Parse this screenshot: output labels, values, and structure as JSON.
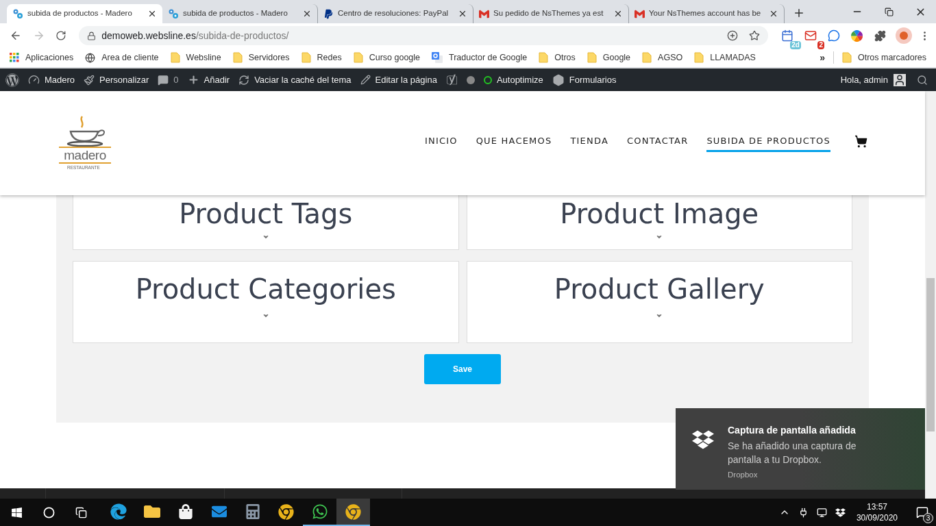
{
  "browser": {
    "tabs": [
      {
        "title": "subida de productos - Madero",
        "kind": "site",
        "selected": true
      },
      {
        "title": "subida de productos - Madero",
        "kind": "site",
        "selected": false
      },
      {
        "title": "Centro de resoluciones: PayPal",
        "kind": "paypal",
        "selected": false
      },
      {
        "title": "Su pedido de NsThemes ya est",
        "kind": "gmail",
        "selected": false
      },
      {
        "title": "Your NsThemes account has be",
        "kind": "gmail",
        "selected": false
      }
    ],
    "address": {
      "host": "demoweb.websline.es",
      "path": "/subida-de-productos/"
    },
    "extensions": [
      {
        "kind": "calendar",
        "badge": "2d"
      },
      {
        "kind": "mail",
        "badge": "2"
      },
      {
        "kind": "chat"
      },
      {
        "kind": "color"
      },
      {
        "kind": "puzzle"
      },
      {
        "kind": "avatar"
      }
    ],
    "bookmarks": [
      {
        "label": "Aplicaciones",
        "kind": "apps"
      },
      {
        "label": "Area de cliente",
        "kind": "globe"
      },
      {
        "label": "Websline",
        "kind": "folder"
      },
      {
        "label": "Servidores",
        "kind": "folder"
      },
      {
        "label": "Redes",
        "kind": "folder"
      },
      {
        "label": "Curso google",
        "kind": "folder"
      },
      {
        "label": "Traductor de Google",
        "kind": "translate"
      },
      {
        "label": "Otros",
        "kind": "folder"
      },
      {
        "label": "Google",
        "kind": "folder"
      },
      {
        "label": "AGSO",
        "kind": "folder"
      },
      {
        "label": "LLAMADAS",
        "kind": "folder"
      }
    ],
    "bookmarks_overflow": "»",
    "other_bookmarks": "Otros marcadores"
  },
  "admin_bar": {
    "items": [
      {
        "kind": "wordpress"
      },
      {
        "kind": "dashboard",
        "label": "Madero"
      },
      {
        "kind": "brush",
        "label": "Personalizar"
      },
      {
        "kind": "comments",
        "label": "0"
      },
      {
        "kind": "add",
        "label": "Añadir"
      },
      {
        "kind": "refresh",
        "label": "Vaciar la caché del tema"
      },
      {
        "kind": "edit",
        "label": "Editar la página"
      },
      {
        "kind": "yoast"
      },
      {
        "kind": "dot"
      },
      {
        "kind": "ring",
        "label": "Autoptimize"
      },
      {
        "kind": "forms",
        "label": "Formularios"
      }
    ],
    "greeting": "Hola, admin"
  },
  "site": {
    "logo": {
      "name": "madero",
      "tagline": "RESTAURANTE"
    },
    "nav": [
      {
        "label": "INICIO",
        "selected": false
      },
      {
        "label": "QUE HACEMOS",
        "selected": false
      },
      {
        "label": "TIENDA",
        "selected": false
      },
      {
        "label": "CONTACTAR",
        "selected": false
      },
      {
        "label": "SUBIDA DE PRODUCTOS",
        "selected": true
      }
    ],
    "panels": [
      {
        "title": "Product Tags",
        "compact": true
      },
      {
        "title": "Product Image",
        "compact": true
      },
      {
        "title": "Product Categories",
        "compact": false
      },
      {
        "title": "Product Gallery",
        "compact": false
      }
    ],
    "save": "Save"
  },
  "notification": {
    "title": "Captura de pantalla añadida",
    "body": "Se ha añadido una captura de pantalla a tu Dropbox.",
    "source": "Dropbox"
  },
  "taskbar": {
    "apps": [
      {
        "kind": "edge",
        "running": false,
        "selected": false
      },
      {
        "kind": "explorer",
        "running": false,
        "selected": false
      },
      {
        "kind": "store",
        "running": false,
        "selected": false
      },
      {
        "kind": "mail",
        "running": false,
        "selected": false
      },
      {
        "kind": "calculator",
        "running": false,
        "selected": false
      },
      {
        "kind": "chrome",
        "running": false,
        "selected": false
      },
      {
        "kind": "whatsapp",
        "running": true,
        "selected": false
      },
      {
        "kind": "chrome",
        "running": true,
        "selected": true
      }
    ],
    "time": "13:57",
    "date": "30/09/2020",
    "notifications": "3"
  }
}
